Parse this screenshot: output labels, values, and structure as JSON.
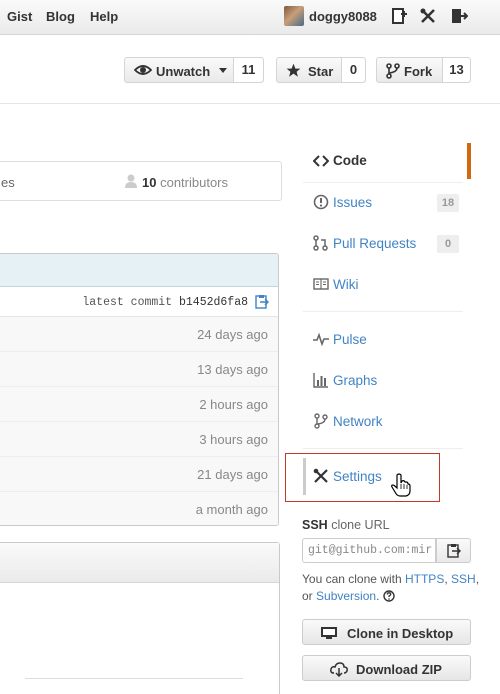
{
  "topbar": {
    "nav": [
      "Gist",
      "Blog",
      "Help"
    ],
    "username": "doggy8088",
    "icons": [
      "create-new-icon",
      "account-settings-icon",
      "sign-out-icon"
    ]
  },
  "pagehead": {
    "watch": {
      "label": "Unwatch",
      "count": "11"
    },
    "star": {
      "label": "Star",
      "count": "0"
    },
    "fork": {
      "label": "Fork",
      "count": "13"
    }
  },
  "summary": {
    "left_fragment": "es",
    "contributors_count": "10",
    "contributors_label": "contributors"
  },
  "files": {
    "latest_commit_label": "latest commit",
    "commit_hash": "b1452d6fa8",
    "ages": [
      "24 days ago",
      "13 days ago",
      "2 hours ago",
      "3 hours ago",
      "21 days ago",
      "a month ago"
    ]
  },
  "sidebar": {
    "items": [
      {
        "label": "Code",
        "icon": "code-icon",
        "selected": true
      },
      {
        "label": "Issues",
        "icon": "issue-icon",
        "count": "18"
      },
      {
        "label": "Pull Requests",
        "icon": "pull-request-icon",
        "count": "0"
      },
      {
        "label": "Wiki",
        "icon": "book-icon"
      },
      {
        "label": "Pulse",
        "icon": "pulse-icon"
      },
      {
        "label": "Graphs",
        "icon": "graph-icon"
      },
      {
        "label": "Network",
        "icon": "network-icon"
      },
      {
        "label": "Settings",
        "icon": "tools-icon",
        "highlighted": true
      }
    ]
  },
  "clone": {
    "protocol": "SSH",
    "label": "clone URL",
    "url": "git@github.com:mir",
    "help_prefix": "You can clone with",
    "https": "HTTPS",
    "ssh": "SSH",
    "or": ", or",
    "subversion": "Subversion",
    "clone_desktop": "Clone in Desktop",
    "download_zip": "Download ZIP"
  },
  "colors": {
    "link": "#4183c4",
    "highlight_box": "#c0392b",
    "code_tab_border": "#d26911"
  }
}
